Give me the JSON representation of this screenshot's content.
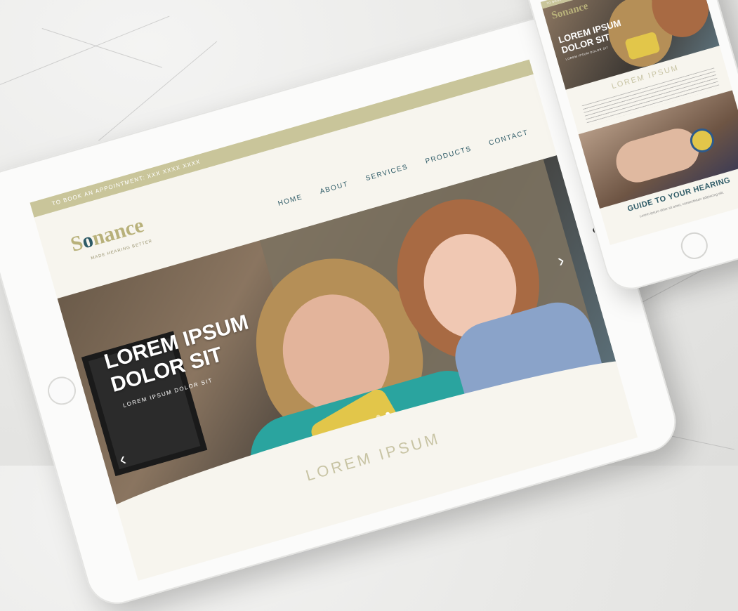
{
  "site": {
    "booking_text": "TO BOOK AN APPOINTMENT: XXX XXXX XXXX",
    "logo_text": "Sonance",
    "tagline": "MADE HEARING BETTER",
    "nav": [
      "HOME",
      "ABOUT",
      "SERVICES",
      "PRODUCTS",
      "CONTACT"
    ],
    "hero_title": "LOREM IPSUM DOLOR SIT",
    "hero_subtitle": "LOREM IPSUM DOLOR SIT",
    "section_title": "LOREM IPSUM",
    "guide_title": "GUIDE TO YOUR HEARING",
    "guide_sub": "Lorem ipsum dolor sit amet, consectetuer adipiscing elit."
  },
  "colors": {
    "accent": "#c9c59a",
    "brand_teal": "#2d5a66",
    "cream": "#f7f5ee"
  },
  "icons": {
    "prev": "chevron-left-icon",
    "next": "chevron-right-icon"
  }
}
